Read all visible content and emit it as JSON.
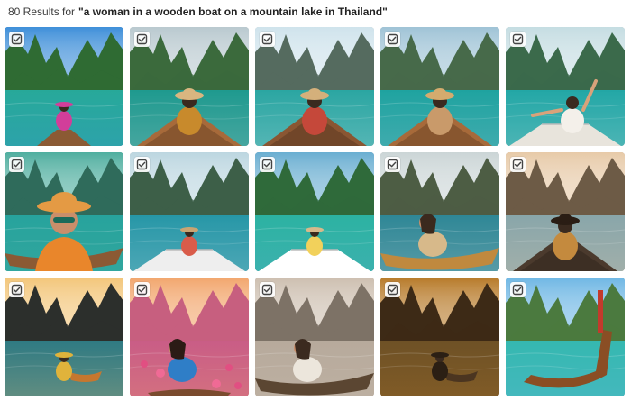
{
  "header": {
    "results_label": "80 Results for",
    "query": "\"a woman in a wooden boat on a mountain lake in Thailand\""
  },
  "badge_icon": "select-checkbox-icon",
  "results": [
    {
      "sky": "#3f8fd9",
      "mountain": "#2f6b33",
      "water": "#27a99a",
      "boat": "#8b5a34",
      "person": "#d23e9a",
      "hat": "#d23e9a",
      "boat_style": "longtail",
      "person_pos": "center-far"
    },
    {
      "sky": "#b9c9cf",
      "mountain": "#3b6a3c",
      "water": "#1f9a8f",
      "boat": "#a76a3a",
      "person": "#c88a2c",
      "hat": "#d9b680",
      "boat_style": "bow",
      "person_pos": "center-back"
    },
    {
      "sky": "#cfe3ec",
      "mountain": "#556b5f",
      "water": "#2ba6a2",
      "boat": "#8a5632",
      "person": "#c5483a",
      "hat": "#d4b07b",
      "boat_style": "bow",
      "person_pos": "center-back"
    },
    {
      "sky": "#9fc3d6",
      "mountain": "#476a4a",
      "water": "#1fa3a0",
      "boat": "#a76a3a",
      "person": "#c99a6a",
      "hat": "#d4ab6e",
      "boat_style": "bow",
      "person_pos": "center-back"
    },
    {
      "sky": "#c5dde2",
      "mountain": "#3b6a4b",
      "water": "#23a7a6",
      "boat": "#e8e4dc",
      "person": "#f4f0ea",
      "hat": "#3a2a1f",
      "boat_style": "white",
      "person_pos": "arms-up"
    },
    {
      "sky": "#4fae9f",
      "mountain": "#2f6b5b",
      "water": "#27a39d",
      "boat": "#8b5a34",
      "person": "#e9862b",
      "hat": "#e49a44",
      "boat_style": "side",
      "person_pos": "close-up"
    },
    {
      "sky": "#bcd6e0",
      "mountain": "#3d5f48",
      "water": "#2797a7",
      "boat": "#eeeeee",
      "person": "#d95c4a",
      "hat": "#c9a472",
      "boat_style": "white",
      "person_pos": "center-far"
    },
    {
      "sky": "#6aaed1",
      "mountain": "#2f6a3a",
      "water": "#2cb2a2",
      "boat": "#ffffff",
      "person": "#f2d15b",
      "hat": "#d8b98b",
      "boat_style": "white",
      "person_pos": "center-far"
    },
    {
      "sky": "#cbd5d6",
      "mountain": "#4d5d44",
      "water": "#2f8796",
      "boat": "#c0893e",
      "person": "#d7b98a",
      "hat": "#3b2a1e",
      "boat_style": "side",
      "person_pos": "side-sit"
    },
    {
      "sky": "#e7caa8",
      "mountain": "#6d5b46",
      "water": "#89a6aa",
      "boat": "#4b3a2d",
      "person": "#c48a3e",
      "hat": "#2a1d14",
      "boat_style": "bow",
      "person_pos": "center-back"
    },
    {
      "sky": "#f3c67a",
      "mountain": "#2c2f2c",
      "water": "#2f7a83",
      "boat": "#c6772f",
      "person": "#e0b33b",
      "hat": "#e0b33b",
      "boat_style": "small",
      "person_pos": "center-far"
    },
    {
      "sky": "#f2a66d",
      "mountain": "#c75f7f",
      "water": "#c95d86",
      "boat": "#7a4b2e",
      "person": "#2f7ec7",
      "hat": "#2b1b15",
      "boat_style": "flowers",
      "person_pos": "side-sit"
    },
    {
      "sky": "#cdbfb0",
      "mountain": "#7d7266",
      "water": "#b7aa9c",
      "boat": "#5b4632",
      "person": "#ece6dc",
      "hat": "#3b2a1f",
      "boat_style": "side",
      "person_pos": "side-sit"
    },
    {
      "sky": "#b77a29",
      "mountain": "#3d2a16",
      "water": "#6e5126",
      "boat": "#4b3520",
      "person": "#2b1f14",
      "hat": "#2b1f14",
      "boat_style": "small",
      "person_pos": "center-far"
    },
    {
      "sky": "#6fb7e4",
      "mountain": "#4b7a3f",
      "water": "#35b8b0",
      "boat": "#8a4e24",
      "person": "#c33a2c",
      "hat": "#c33a2c",
      "boat_style": "longtail-big",
      "person_pos": "none"
    }
  ]
}
